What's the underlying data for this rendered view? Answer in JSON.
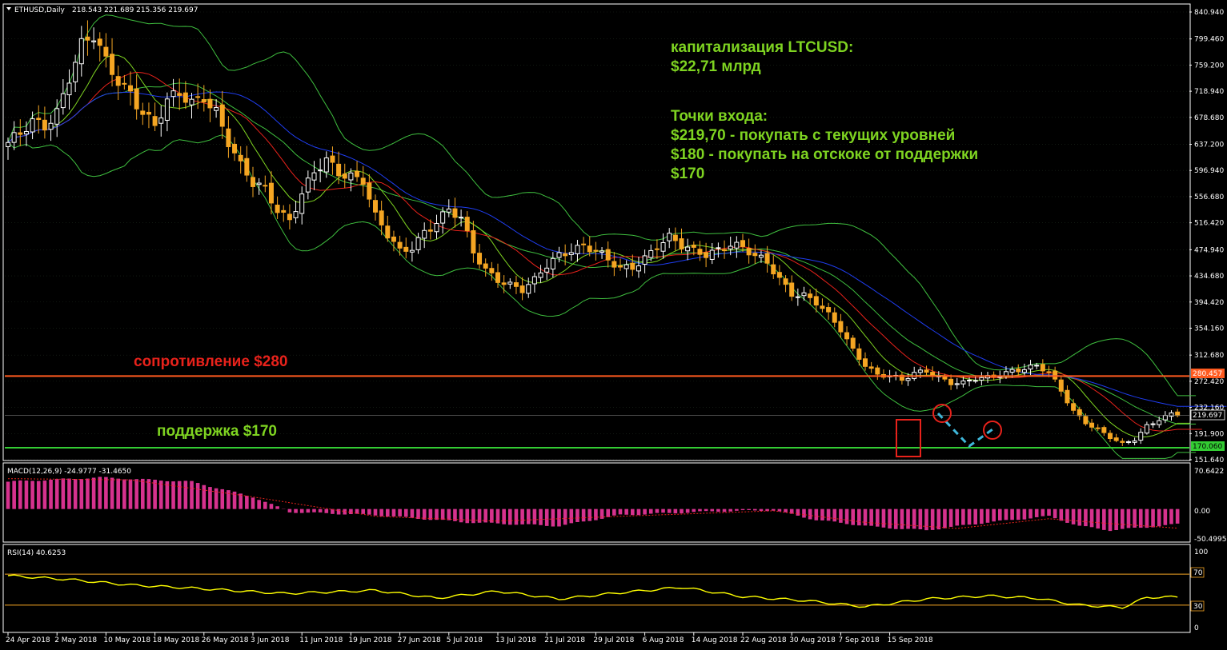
{
  "colors": {
    "background": "#000000",
    "frame": "#ffffff",
    "bull_candle": "#ffffff",
    "bear_candle": "#f5a623",
    "ma_fast": "#7ed321",
    "ma_mid": "#e8221b",
    "ma_slow": "#1f3df0",
    "bollinger": "#3fbf3f",
    "resistance": "#ff5a1f",
    "support": "#33cc33",
    "macd_hist": "#d6328e",
    "macd_signal": "#e8221b",
    "rsi_line": "#ffff00",
    "rsi_level": "#f5a623",
    "forecast": "#3fb7d9",
    "marker": "#e8221b"
  },
  "header": {
    "symbol_label": "ETHUSD,Daily",
    "ohlc": "218.543 221.689 215.356 219.697"
  },
  "annotations": {
    "cap_line1": "капитализация LTCUSD:",
    "cap_line2": "$22,71 млрд",
    "entry_title": "Точки входа:",
    "entry_1": "$219,70 - покупать с текущих уровней",
    "entry_2": "$180 - покупать на отскоке от поддержки",
    "entry_3": "$170",
    "resistance_label": "сопротивление $280",
    "support_label": "поддержка $170"
  },
  "price_badges": {
    "resistance": "280.457",
    "current": "219.697",
    "support": "170.060"
  },
  "macd_panel": {
    "label": "MACD(12,26,9) -24.9777 -31.4650",
    "ticks": [
      "70.6422",
      "0.00",
      "-50.4995"
    ]
  },
  "rsi_panel": {
    "label": "RSI(14) 40.6253",
    "ticks": [
      "100",
      "70",
      "30",
      "0"
    ]
  },
  "chart_data": {
    "type": "candlestick",
    "symbol": "ETHUSD",
    "timeframe": "Daily",
    "y_ticks": [
      "840.940",
      "799.460",
      "759.200",
      "718.940",
      "678.680",
      "637.200",
      "596.940",
      "556.680",
      "516.420",
      "474.940",
      "434.680",
      "394.420",
      "354.160",
      "312.680",
      "272.420",
      "232.160",
      "191.900",
      "151.640"
    ],
    "ylim": [
      151.64,
      840.94
    ],
    "x_labels": [
      "24 Apr 2018",
      "2 May 2018",
      "10 May 2018",
      "18 May 2018",
      "26 May 2018",
      "3 Jun 2018",
      "11 Jun 2018",
      "19 Jun 2018",
      "27 Jun 2018",
      "5 Jul 2018",
      "13 Jul 2018",
      "21 Jul 2018",
      "29 Jul 2018",
      "6 Aug 2018",
      "14 Aug 2018",
      "22 Aug 2018",
      "30 Aug 2018",
      "7 Sep 2018",
      "15 Sep 2018"
    ],
    "close_path": [
      [
        0,
        640
      ],
      [
        2,
        650
      ],
      [
        4,
        668
      ],
      [
        6,
        665
      ],
      [
        8,
        690
      ],
      [
        10,
        745
      ],
      [
        12,
        790
      ],
      [
        14,
        800
      ],
      [
        16,
        760
      ],
      [
        18,
        735
      ],
      [
        20,
        720
      ],
      [
        22,
        690
      ],
      [
        24,
        665
      ],
      [
        26,
        700
      ],
      [
        28,
        712
      ],
      [
        30,
        702
      ],
      [
        32,
        715
      ],
      [
        34,
        690
      ],
      [
        36,
        640
      ],
      [
        38,
        600
      ],
      [
        40,
        575
      ],
      [
        42,
        570
      ],
      [
        44,
        540
      ],
      [
        46,
        522
      ],
      [
        48,
        560
      ],
      [
        50,
        590
      ],
      [
        52,
        610
      ],
      [
        54,
        595
      ],
      [
        56,
        592
      ],
      [
        58,
        585
      ],
      [
        60,
        525
      ],
      [
        62,
        495
      ],
      [
        64,
        470
      ],
      [
        66,
        480
      ],
      [
        68,
        505
      ],
      [
        70,
        520
      ],
      [
        72,
        535
      ],
      [
        74,
        520
      ],
      [
        76,
        470
      ],
      [
        78,
        445
      ],
      [
        80,
        432
      ],
      [
        82,
        422
      ],
      [
        84,
        412
      ],
      [
        86,
        425
      ],
      [
        88,
        450
      ],
      [
        90,
        468
      ],
      [
        92,
        478
      ],
      [
        94,
        482
      ],
      [
        96,
        472
      ],
      [
        98,
        456
      ],
      [
        100,
        445
      ],
      [
        102,
        450
      ],
      [
        104,
        465
      ],
      [
        106,
        482
      ],
      [
        108,
        492
      ],
      [
        110,
        478
      ],
      [
        112,
        472
      ],
      [
        114,
        470
      ],
      [
        116,
        478
      ],
      [
        118,
        484
      ],
      [
        120,
        476
      ],
      [
        122,
        462
      ],
      [
        124,
        455
      ],
      [
        126,
        432
      ],
      [
        128,
        410
      ],
      [
        130,
        405
      ],
      [
        132,
        392
      ],
      [
        134,
        372
      ],
      [
        136,
        352
      ],
      [
        138,
        322
      ],
      [
        140,
        300
      ],
      [
        142,
        282
      ],
      [
        144,
        280
      ],
      [
        146,
        272
      ],
      [
        148,
        285
      ],
      [
        150,
        290
      ],
      [
        152,
        280
      ],
      [
        154,
        270
      ],
      [
        156,
        268
      ],
      [
        158,
        275
      ],
      [
        160,
        278
      ],
      [
        162,
        285
      ],
      [
        164,
        290
      ],
      [
        166,
        292
      ],
      [
        168,
        294
      ],
      [
        170,
        285
      ],
      [
        172,
        258
      ],
      [
        174,
        228
      ],
      [
        176,
        210
      ],
      [
        178,
        198
      ],
      [
        180,
        185
      ],
      [
        182,
        175
      ],
      [
        184,
        183
      ],
      [
        186,
        205
      ],
      [
        188,
        215
      ],
      [
        190,
        222
      ],
      [
        191,
        219.7
      ]
    ],
    "resistance": 280.457,
    "support": 170.06,
    "current": 219.697,
    "macd": {
      "range": [
        -50.4995,
        70.6422
      ],
      "hist_path": [
        [
          0,
          45
        ],
        [
          15,
          52
        ],
        [
          30,
          45
        ],
        [
          40,
          20
        ],
        [
          46,
          -5
        ],
        [
          60,
          -10
        ],
        [
          75,
          -22
        ],
        [
          90,
          -28
        ],
        [
          100,
          -10
        ],
        [
          115,
          -4
        ],
        [
          125,
          -2
        ],
        [
          132,
          -18
        ],
        [
          142,
          -30
        ],
        [
          150,
          -35
        ],
        [
          160,
          -22
        ],
        [
          170,
          -12
        ],
        [
          175,
          -28
        ],
        [
          180,
          -35
        ],
        [
          186,
          -30
        ],
        [
          191,
          -25
        ]
      ],
      "signal_path": [
        [
          0,
          50
        ],
        [
          20,
          48
        ],
        [
          40,
          20
        ],
        [
          60,
          -12
        ],
        [
          80,
          -20
        ],
        [
          100,
          -12
        ],
        [
          125,
          -3
        ],
        [
          140,
          -22
        ],
        [
          155,
          -32
        ],
        [
          170,
          -16
        ],
        [
          180,
          -24
        ],
        [
          191,
          -31.5
        ]
      ]
    },
    "rsi": {
      "levels": [
        70,
        30
      ],
      "path": [
        [
          0,
          68
        ],
        [
          10,
          63
        ],
        [
          20,
          56
        ],
        [
          30,
          52
        ],
        [
          45,
          45
        ],
        [
          60,
          49
        ],
        [
          70,
          39
        ],
        [
          80,
          48
        ],
        [
          90,
          38
        ],
        [
          100,
          46
        ],
        [
          110,
          53
        ],
        [
          120,
          41
        ],
        [
          130,
          36
        ],
        [
          140,
          28
        ],
        [
          150,
          38
        ],
        [
          160,
          42
        ],
        [
          168,
          39
        ],
        [
          175,
          30
        ],
        [
          182,
          27
        ],
        [
          186,
          40
        ],
        [
          191,
          40.6
        ]
      ]
    }
  }
}
